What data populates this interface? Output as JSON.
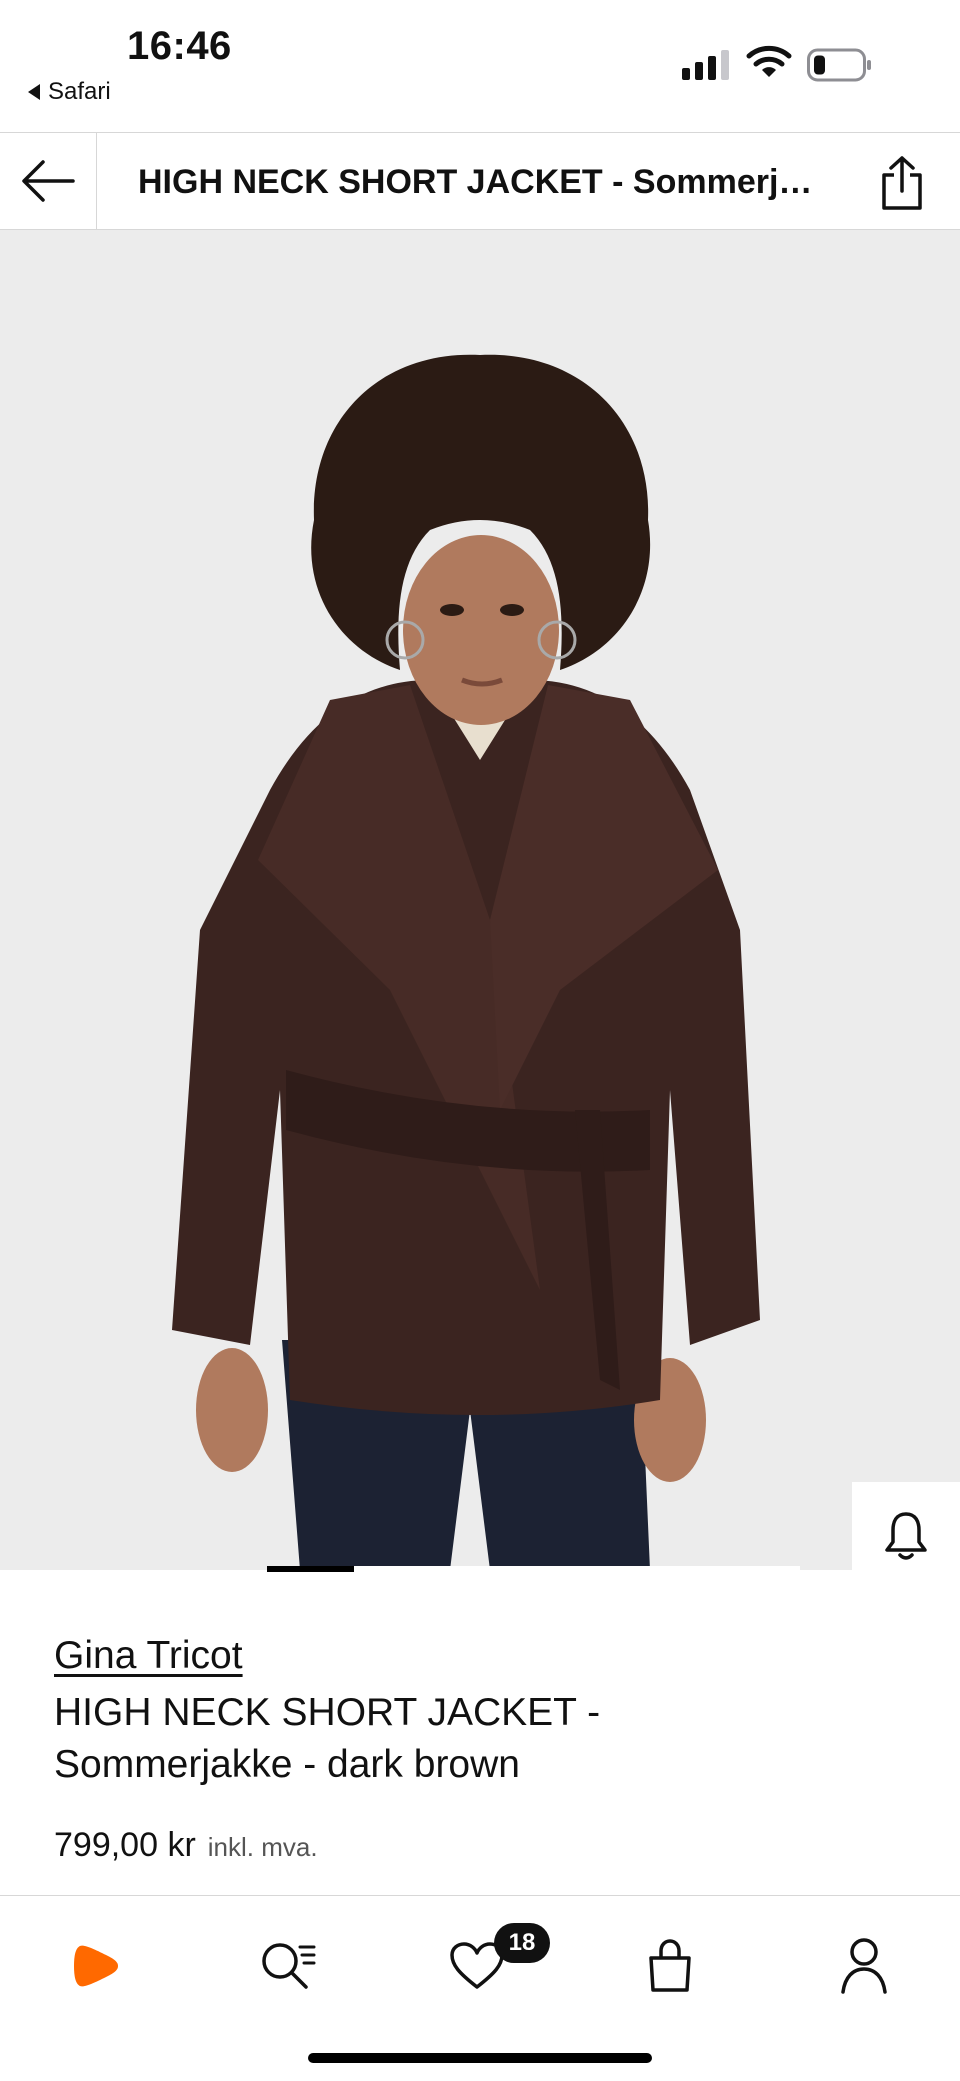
{
  "status_bar": {
    "time": "16:46",
    "back_app": "Safari",
    "signal_icon": "signal-strength-icon",
    "wifi_icon": "wifi-icon",
    "battery_icon": "battery-low-icon"
  },
  "header": {
    "back_icon": "arrow-left-icon",
    "title": "HIGH NECK SHORT JACKET - Sommerjakke - dark brown",
    "share_icon": "share-icon"
  },
  "product_image": {
    "compare_icon": "similar-items-icon",
    "actions": [
      {
        "name": "notify",
        "icon": "bell-icon"
      },
      {
        "name": "wishlist",
        "icon": "heart-icon"
      },
      {
        "name": "add-to-bag",
        "icon": "shopping-bag-icon"
      }
    ],
    "carousel_position": 1
  },
  "product": {
    "brand": "Gina Tricot",
    "name_line1": "HIGH NECK SHORT JACKET -",
    "name_line2": "Sommerjakke - dark brown",
    "price": "799,00 kr",
    "vat_note": "inkl. mva."
  },
  "bottom_nav": {
    "items": [
      {
        "name": "home",
        "icon": "zalando-logo-icon"
      },
      {
        "name": "search",
        "icon": "search-icon"
      },
      {
        "name": "wishlist",
        "icon": "heart-icon"
      },
      {
        "name": "bag",
        "icon": "shopping-bag-icon"
      },
      {
        "name": "profile",
        "icon": "user-icon"
      }
    ],
    "wishlist_count": "18"
  },
  "colors": {
    "brand_orange": "#ff6900",
    "jacket_brown": "#3b2420",
    "background_gray": "#ececec"
  }
}
